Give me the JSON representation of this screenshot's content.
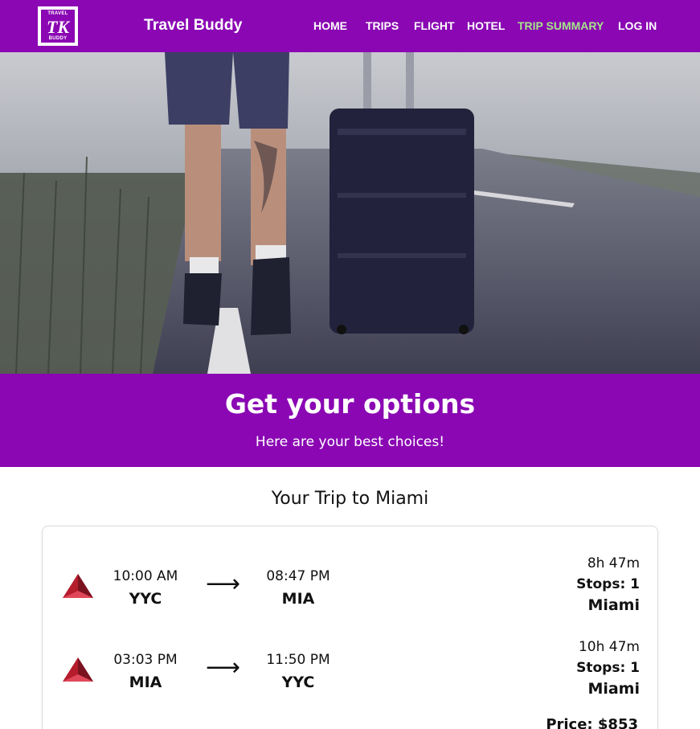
{
  "nav": {
    "logo_top": "TRAVEL",
    "logo_mark": "TK",
    "logo_bottom": "BUDDY",
    "brand": "Travel Buddy",
    "links": [
      {
        "label": "HOME"
      },
      {
        "label": "TRIPS"
      },
      {
        "label": "FLIGHT"
      },
      {
        "label": "HOTEL"
      },
      {
        "label": "TRIP SUMMARY",
        "active": true
      },
      {
        "label": "LOG IN"
      }
    ]
  },
  "banner": {
    "title": "Get your options",
    "subtitle": "Here are your best choices!"
  },
  "trip": {
    "title": "Your Trip to Miami",
    "flights": [
      {
        "depart_time": "10:00 AM",
        "depart_code": "YYC",
        "arrive_time": "08:47 PM",
        "arrive_code": "MIA",
        "duration": "8h 47m",
        "stops": "Stops: 1",
        "destination": "Miami"
      },
      {
        "depart_time": "03:03 PM",
        "depart_code": "MIA",
        "arrive_time": "11:50 PM",
        "arrive_code": "YYC",
        "duration": "10h 47m",
        "stops": "Stops: 1",
        "destination": "Miami"
      }
    ],
    "price": "Price: $853",
    "arrow": "⟶"
  },
  "colors": {
    "brand_purple": "#8a07b3",
    "active_link": "#a6e68a",
    "airline_red": "#b51d2d"
  },
  "icons": {
    "airline": "delta-widget-icon",
    "hero": "hero-traveler-road-image"
  }
}
